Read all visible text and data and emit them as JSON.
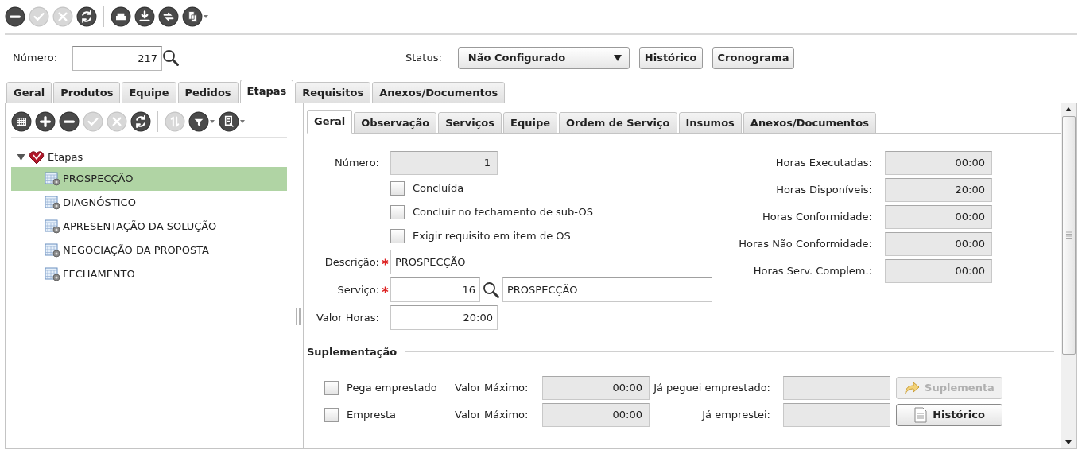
{
  "toolbar_groups": [
    {
      "buttons": [
        {
          "kind": "remove",
          "disabled": false,
          "menu": false
        },
        {
          "kind": "confirm",
          "disabled": true,
          "menu": false
        },
        {
          "kind": "cancel",
          "disabled": true,
          "menu": false
        },
        {
          "kind": "refresh",
          "disabled": false,
          "menu": false
        }
      ]
    },
    {
      "buttons": [
        {
          "kind": "print",
          "disabled": false,
          "menu": false
        },
        {
          "kind": "download",
          "disabled": false,
          "menu": false
        },
        {
          "kind": "transfer",
          "disabled": false,
          "menu": false
        },
        {
          "kind": "copy",
          "disabled": false,
          "menu": true
        }
      ]
    }
  ],
  "header": {
    "numero": {
      "label": "Número:",
      "value": "217"
    },
    "status": {
      "label": "Status:",
      "value": "Não Configurado"
    },
    "buttons": [
      "Histórico",
      "Cronograma"
    ]
  },
  "tabs": [
    {
      "label": "Geral",
      "selected": false
    },
    {
      "label": "Produtos",
      "selected": false
    },
    {
      "label": "Equipe",
      "selected": false
    },
    {
      "label": "Pedidos",
      "selected": false
    },
    {
      "label": "Etapas",
      "selected": true
    },
    {
      "label": "Requisitos",
      "selected": false
    },
    {
      "label": "Anexos/Documentos",
      "selected": false
    }
  ],
  "tree_toolbar_groups": [
    {
      "buttons": [
        {
          "kind": "grid",
          "disabled": false,
          "menu": false
        },
        {
          "kind": "add",
          "disabled": false,
          "menu": false
        },
        {
          "kind": "remove",
          "disabled": false,
          "menu": false
        },
        {
          "kind": "confirm",
          "disabled": true,
          "menu": false
        },
        {
          "kind": "cancel",
          "disabled": true,
          "menu": false
        },
        {
          "kind": "refresh",
          "disabled": false,
          "menu": false
        }
      ]
    },
    {
      "buttons": [
        {
          "kind": "sort",
          "disabled": true,
          "menu": false
        },
        {
          "kind": "filter",
          "disabled": false,
          "menu": true
        },
        {
          "kind": "export",
          "disabled": false,
          "menu": true
        }
      ]
    }
  ],
  "tree": {
    "label": "Etapas",
    "expanded": true,
    "children": [
      {
        "label": "PROSPECÇÃO",
        "selected": true
      },
      {
        "label": "DIAGNÓSTICO",
        "selected": false
      },
      {
        "label": "APRESENTAÇÃO DA SOLUÇÃO",
        "selected": false
      },
      {
        "label": "NEGOCIAÇÃO DA PROPOSTA",
        "selected": false
      },
      {
        "label": "FECHAMENTO",
        "selected": false
      }
    ]
  },
  "subtabs": [
    {
      "label": "Geral",
      "selected": true
    },
    {
      "label": "Observação",
      "selected": false
    },
    {
      "label": "Serviços",
      "selected": false
    },
    {
      "label": "Equipe",
      "selected": false
    },
    {
      "label": "Ordem de Serviço",
      "selected": false
    },
    {
      "label": "Insumos",
      "selected": false
    },
    {
      "label": "Anexos/Documentos",
      "selected": false
    }
  ],
  "form": {
    "numero": {
      "label": "Número:",
      "value": "1"
    },
    "checkboxes": [
      {
        "label": "Concluída",
        "checked": false
      },
      {
        "label": "Concluir no fechamento de sub-OS",
        "checked": false
      },
      {
        "label": "Exigir requisito em item de OS",
        "checked": false
      }
    ],
    "descricao": {
      "label": "Descrição:",
      "required": true,
      "value": "PROSPECÇÃO"
    },
    "servico": {
      "label": "Serviço:",
      "required": true,
      "code": "16",
      "name": "PROSPECÇÃO"
    },
    "valor_horas": {
      "label": "Valor Horas:",
      "value": "20:00"
    }
  },
  "hours": [
    {
      "label": "Horas Executadas:",
      "value": "00:00"
    },
    {
      "label": "Horas Disponíveis:",
      "value": "20:00"
    },
    {
      "label": "Horas Conformidade:",
      "value": "00:00"
    },
    {
      "label": "Horas Não Conformidade:",
      "value": "00:00"
    },
    {
      "label": "Horas Serv. Complem.:",
      "value": "00:00"
    }
  ],
  "suplementacao": {
    "title": "Suplementação",
    "rows": [
      {
        "label": "Pega emprestado",
        "checked": false,
        "max_label": "Valor Máximo:",
        "max_value": "00:00",
        "other_label": "Já peguei emprestado:",
        "button": {
          "kind": "suplementa",
          "label": "Suplementa",
          "disabled": true
        }
      },
      {
        "label": "Empresta",
        "checked": false,
        "max_label": "Valor Máximo:",
        "max_value": "00:00",
        "other_label": "Já emprestei:",
        "button": {
          "kind": "historico",
          "label": "Histórico",
          "disabled": false
        }
      }
    ]
  }
}
